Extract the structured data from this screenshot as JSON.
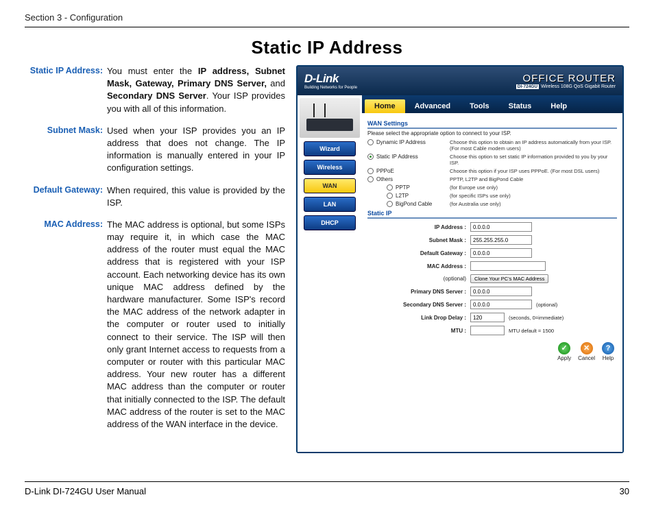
{
  "header": "Section 3 - Configuration",
  "title": "Static IP Address",
  "defs": [
    {
      "label": "Static IP Address:",
      "html": "static_ip"
    },
    {
      "label": "Subnet Mask:",
      "html": "subnet"
    },
    {
      "label": "Default Gateway:",
      "html": "gateway"
    },
    {
      "label": "MAC Address:",
      "html": "mac"
    }
  ],
  "def_texts": {
    "subnet": "Used when your ISP provides you an IP address that does not change. The IP information is manually entered in your IP configuration settings.",
    "gateway": "When required, this value is provided by the ISP.",
    "mac": "The MAC address is optional, but some ISPs may require it, in which case the MAC address of the router must equal the MAC address that is registered with your ISP account. Each networking device has its own unique MAC address defined by the hardware manufacturer. Some ISP's record the MAC address of the network adapter in the computer or router used to initially connect to their service. The ISP will then only grant Internet access to requests from a computer or router with this particular MAC address. Your new router has a different MAC address than the computer or router that initially connected to the ISP. The default MAC address of the router is set to the MAC address of the WAN interface in the device."
  },
  "static_ip_plain": "You must enter the ",
  "static_ip_bold1": "IP address, Subnet Mask, Gateway, Primary DNS Server,",
  "static_ip_mid": " and ",
  "static_ip_bold2": "Secondary DNS Server",
  "static_ip_tail": ". Your ISP provides you with all of this information.",
  "router": {
    "logo": "D-Link",
    "logo_sub": "Building Networks for People",
    "title": "OFFICE ROUTER",
    "model": "DI-724GU",
    "subtitle": "Wireless 108G QoS Gigabit Router",
    "tabs": [
      "Home",
      "Advanced",
      "Tools",
      "Status",
      "Help"
    ],
    "sidebar": [
      "Wizard",
      "Wireless",
      "WAN",
      "LAN",
      "DHCP"
    ],
    "section_title": "WAN Settings",
    "section_desc": "Please select the appropriate option to connect to your ISP.",
    "options": [
      {
        "label": "Dynamic IP Address",
        "checked": false,
        "desc": "Choose this option to obtain an IP address automatically from your ISP. (For most Cable modem users)"
      },
      {
        "label": "Static IP Address",
        "checked": true,
        "desc": "Choose this option to set static IP information provided to you by your ISP."
      },
      {
        "label": "PPPoE",
        "checked": false,
        "desc": "Choose this option if your ISP uses PPPoE. (For most DSL users)"
      },
      {
        "label": "Others",
        "checked": false,
        "desc": "PPTP, L2TP and BigPond Cable"
      }
    ],
    "sub_options": [
      {
        "label": "PPTP",
        "desc": "(for Europe use only)"
      },
      {
        "label": "L2TP",
        "desc": "(for specific ISPs use only)"
      },
      {
        "label": "BigPond Cable",
        "desc": "(for Australia use only)"
      }
    ],
    "static_section": "Static IP",
    "fields": {
      "ip_label": "IP Address :",
      "ip": "0.0.0.0",
      "subnet_label": "Subnet Mask :",
      "subnet": "255.255.255.0",
      "gateway_label": "Default Gateway :",
      "gateway": "0.0.0.0",
      "mac_label": "MAC Address :",
      "mac": "",
      "optional_label": "(optional)",
      "clone_btn": "Clone Your PC's MAC Address",
      "dns1_label": "Primary DNS Server :",
      "dns1": "0.0.0.0",
      "dns2_label": "Secondary DNS Server :",
      "dns2": "0.0.0.0",
      "dns2_suffix": "(optional)",
      "delay_label": "Link Drop Delay :",
      "delay": "120",
      "delay_suffix": "(seconds, 0=immediate)",
      "mtu_label": "MTU :",
      "mtu": "",
      "mtu_suffix": "MTU default = 1500"
    },
    "actions": {
      "apply": "Apply",
      "cancel": "Cancel",
      "help": "Help"
    }
  },
  "footer": {
    "left": "D-Link DI-724GU User Manual",
    "right": "30"
  }
}
